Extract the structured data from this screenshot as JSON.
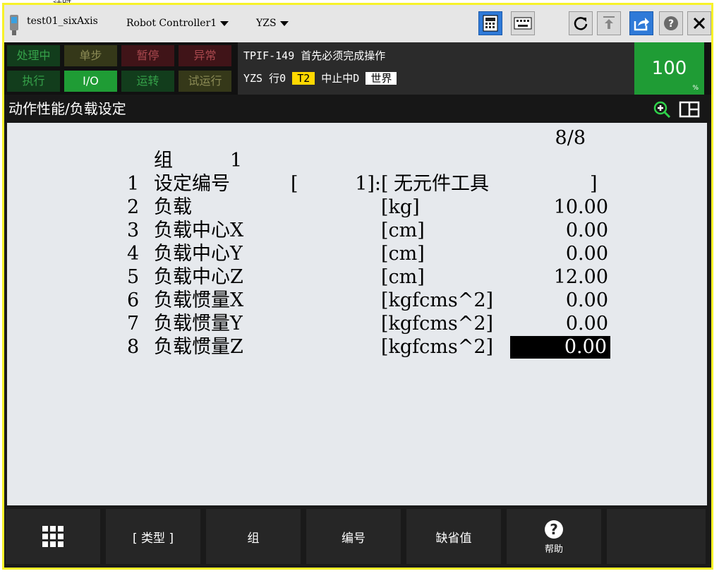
{
  "background_peek": "计时",
  "titlebar": {
    "program": "test01_sixAxis",
    "controller": "Robot Controller1",
    "group": "YZS",
    "buttons": [
      "keypad-icon",
      "keyboard-icon",
      "refresh-icon",
      "step-icon",
      "share-icon",
      "help-icon",
      "close-icon"
    ]
  },
  "status": {
    "row1": [
      "处理中",
      "单步",
      "暂停",
      "异常"
    ],
    "row2": [
      "执行",
      "I/O",
      "运转",
      "试运行"
    ],
    "message": "TPIF-149 首先必须完成操作",
    "program_line": "YZS 行0",
    "mode_badge": "T2",
    "stop_text": "中止中D",
    "coord_badge": "世界",
    "override": "100",
    "override_unit": "%"
  },
  "screen": {
    "title": "动作性能/负载设定"
  },
  "content": {
    "page": "8/8",
    "group_label": "组",
    "group_value": "1",
    "setting": {
      "num": "1",
      "label": "设定编号",
      "lbracket": "[",
      "value": "1]:",
      "tool_lbracket": "[",
      "tool_name": "无元件工具",
      "tool_rbracket": "]"
    },
    "rows": [
      {
        "num": "2",
        "label": "负载",
        "unit": "[kg]",
        "value": "10.00"
      },
      {
        "num": "3",
        "label": "负载中心X",
        "unit": "[cm]",
        "value": "0.00"
      },
      {
        "num": "4",
        "label": "负载中心Y",
        "unit": "[cm]",
        "value": "0.00"
      },
      {
        "num": "5",
        "label": "负载中心Z",
        "unit": "[cm]",
        "value": "12.00"
      },
      {
        "num": "6",
        "label": "负载惯量X",
        "unit": "[kgfcms^2]",
        "value": "0.00"
      },
      {
        "num": "7",
        "label": "负载惯量Y",
        "unit": "[kgfcms^2]",
        "value": "0.00"
      },
      {
        "num": "8",
        "label": "负载惯量Z",
        "unit": "[kgfcms^2]",
        "value": "0.00"
      }
    ],
    "selected_row": "8"
  },
  "fkeys": {
    "f1": "[ 类型 ]",
    "f2": "组",
    "f3": "编号",
    "f4": "缺省值",
    "f5": "帮助"
  }
}
